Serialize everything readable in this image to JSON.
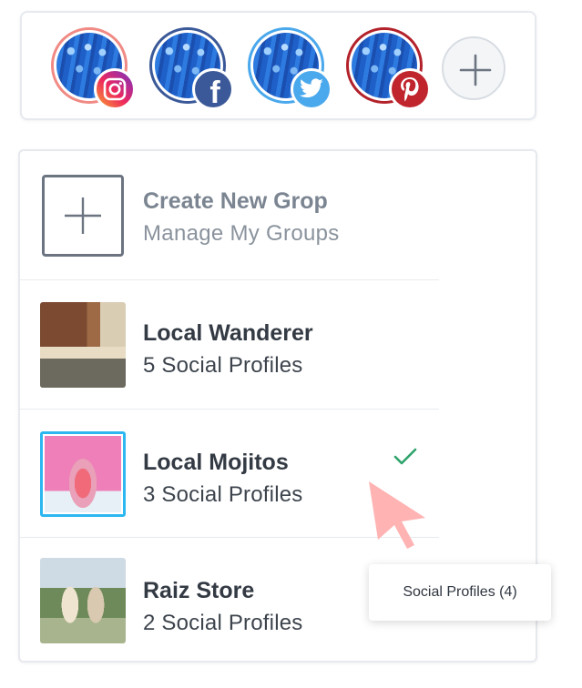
{
  "profiles": [
    {
      "network": "instagram",
      "ring_color": "#f08a85",
      "badge_icon": "instagram-icon"
    },
    {
      "network": "facebook",
      "ring_color": "#3b5998",
      "badge_icon": "facebook-icon"
    },
    {
      "network": "twitter",
      "ring_color": "#4aa8ec",
      "badge_icon": "twitter-icon"
    },
    {
      "network": "pinterest",
      "ring_color": "#b3222b",
      "badge_icon": "pinterest-icon"
    }
  ],
  "add_profile_icon": "plus-icon",
  "create_group": {
    "title": "Create New Grop",
    "manage_link": "Manage My Groups"
  },
  "groups": [
    {
      "name": "Local Wanderer",
      "count_label": "5 Social Profiles",
      "selected": false
    },
    {
      "name": "Local Mojitos",
      "count_label": "3 Social Profiles",
      "selected": true
    },
    {
      "name": "Raiz Store",
      "count_label": "2 Social Profiles",
      "selected": false
    }
  ],
  "tooltip": "Social Profiles (4)",
  "colors": {
    "selected_border": "#2cb7f0",
    "check": "#2ea36b",
    "cursor": "#ffb3b3"
  }
}
